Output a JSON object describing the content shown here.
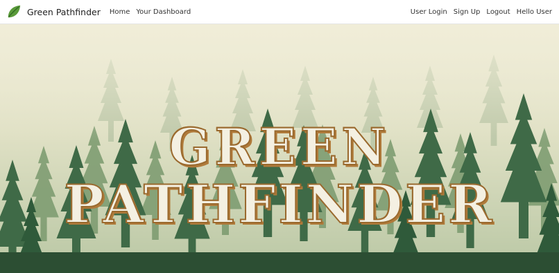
{
  "brand": {
    "name": "Green Pathfinder",
    "logo_icon": "leaf-icon"
  },
  "nav": {
    "left": [
      {
        "label": "Home"
      },
      {
        "label": "Your Dashboard"
      }
    ],
    "right": [
      {
        "label": "User Login"
      },
      {
        "label": "Sign Up"
      },
      {
        "label": "Logout"
      },
      {
        "label": "Hello User"
      }
    ]
  },
  "hero": {
    "title_line1": "GREEN",
    "title_line2": "PATHFINDER",
    "background": "misty-pine-forest"
  },
  "colors": {
    "brand_green": "#5a9a3a",
    "title_fill": "#f4f0e2",
    "title_outline": "#9a6a2f",
    "forest_dark": "#2f5a3a"
  }
}
